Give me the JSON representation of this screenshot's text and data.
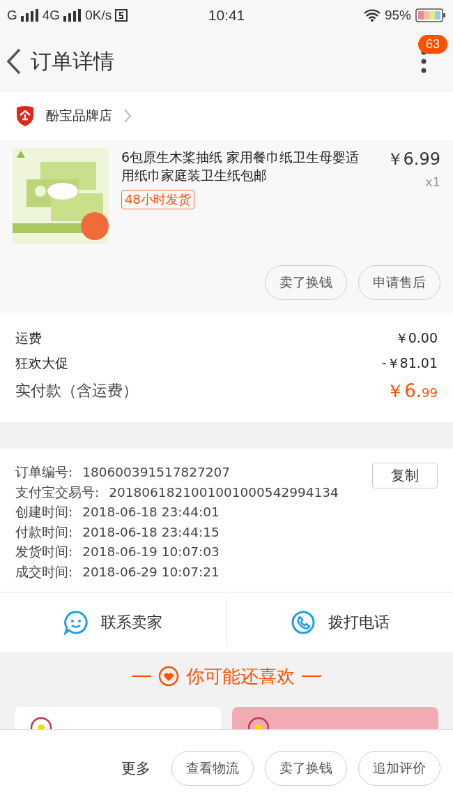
{
  "status_bar": {
    "carrier1": "G",
    "carrier2": "4G",
    "speed": "0K/s",
    "time": "10:41",
    "battery": "95%"
  },
  "header": {
    "title": "订单详情",
    "badge": "63"
  },
  "shop": {
    "name": "酚宝品牌店"
  },
  "product": {
    "kind": "picture",
    "title": "6包原生木桨抽纸 家用餐巾纸卫生母婴适用纸巾家庭装卫生纸包邮",
    "price": "￥6.99",
    "quantity": "x1",
    "tag": "48小时发货",
    "buttons": [
      "卖了换钱",
      "申请售后"
    ]
  },
  "fees": [
    {
      "label": "运费",
      "value": "￥0.00",
      "kind": "plain"
    },
    {
      "label": "狂欢大促",
      "value": "-￥81.01",
      "kind": "plain"
    },
    {
      "label": "实付款（含运费）",
      "value": "￥6.",
      "value_small": "99",
      "kind": "total"
    }
  ],
  "order_info": {
    "copy_button": "复制",
    "rows": [
      {
        "label": "订单编号:",
        "value": "180600391517827207"
      },
      {
        "label": "支付宝交易号:",
        "value": "2018061821001001000542994134"
      },
      {
        "label": "创建时间:",
        "value": "2018-06-18 23:44:01"
      },
      {
        "label": "付款时间:",
        "value": "2018-06-18 23:44:15"
      },
      {
        "label": "发货时间:",
        "value": "2018-06-19 10:07:03"
      },
      {
        "label": "成交时间:",
        "value": "2018-06-29 10:07:21"
      }
    ]
  },
  "contact": [
    {
      "label": "联系卖家",
      "kind": "chat"
    },
    {
      "label": "拨打电话",
      "kind": "phone"
    }
  ],
  "recommend": {
    "title": "你可能还喜欢"
  },
  "bottom_bar": {
    "more": "更多",
    "buttons": [
      "查看物流",
      "卖了换钱",
      "追加评价"
    ]
  }
}
